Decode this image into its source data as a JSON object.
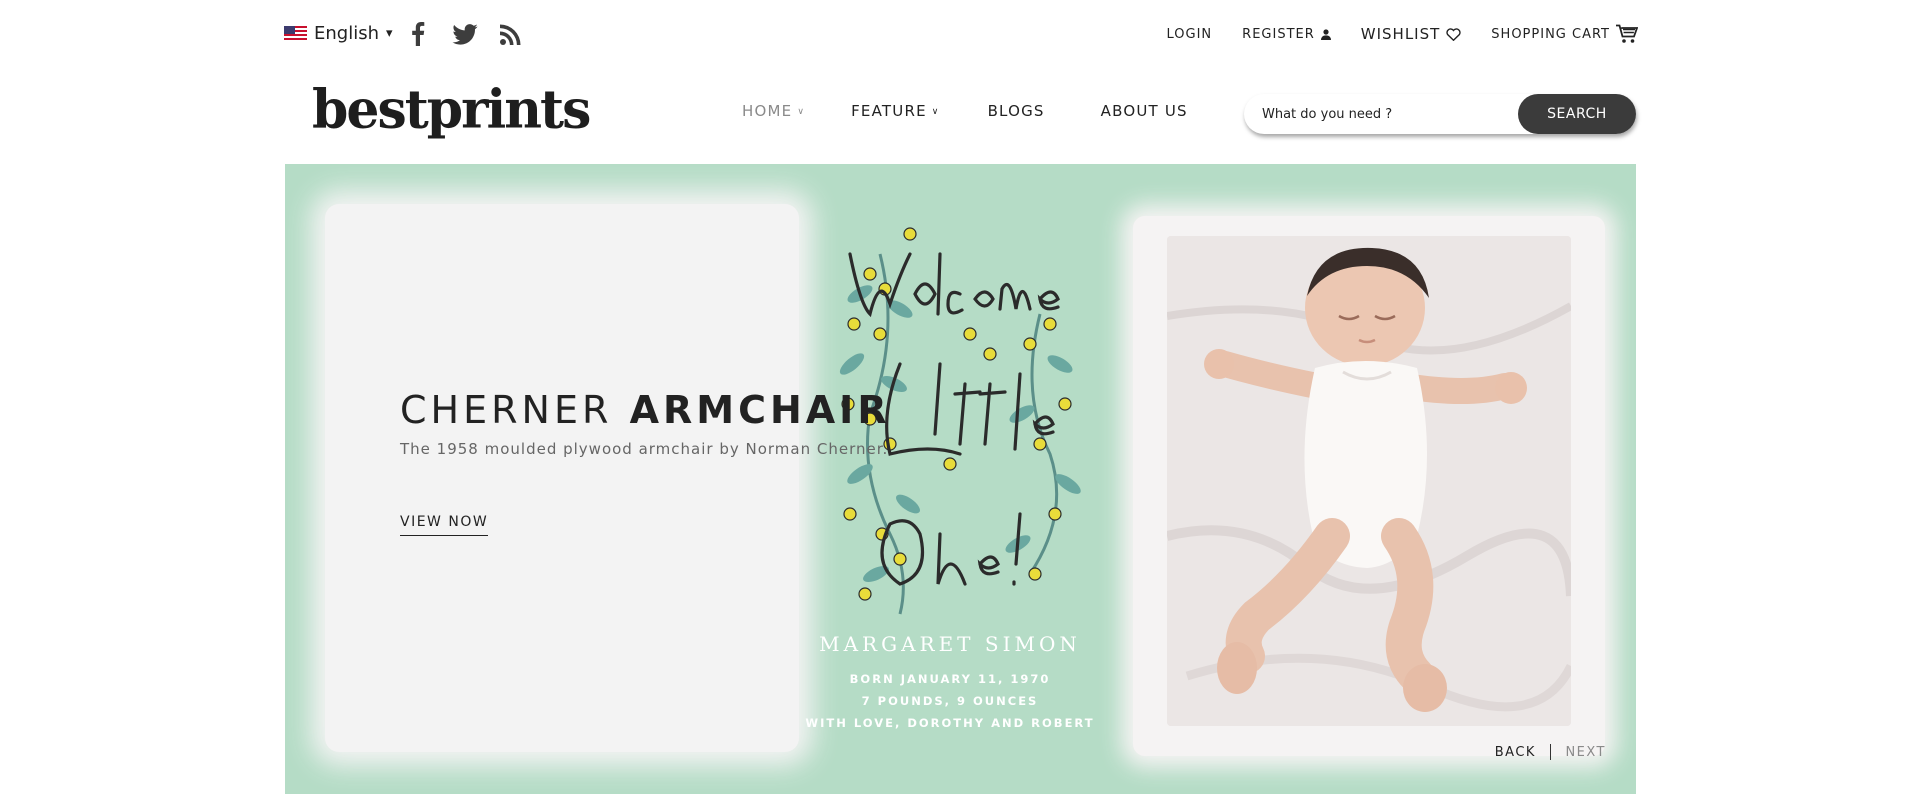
{
  "topbar": {
    "language": {
      "label": "English",
      "caret": "▾",
      "flag_icon": "us-flag-icon"
    },
    "social": [
      {
        "name": "facebook",
        "icon": "facebook-icon"
      },
      {
        "name": "twitter",
        "icon": "twitter-icon"
      },
      {
        "name": "rss",
        "icon": "rss-icon"
      }
    ],
    "links": {
      "login": "LOGIN",
      "register": "REGISTER",
      "wishlist": "WISHLIST",
      "cart": "SHOPPING CART"
    }
  },
  "header": {
    "logo": "bestprints",
    "nav": [
      {
        "label": "HOME",
        "has_dropdown": true,
        "active": true
      },
      {
        "label": "FEATURE",
        "has_dropdown": true,
        "active": false
      },
      {
        "label": "BLOGS",
        "has_dropdown": false,
        "active": false
      },
      {
        "label": "ABOUT US",
        "has_dropdown": false,
        "active": false
      }
    ],
    "search": {
      "placeholder": "What do you need ?",
      "button_label": "SEARCH"
    }
  },
  "hero": {
    "title_light": "CHERNER",
    "title_bold": "ARMCHAIR",
    "subtitle": "The 1958 moulded plywood armchair by Norman Cherner.",
    "cta": "VIEW NOW",
    "card": {
      "name": "MARGARET SIMON",
      "line1": "BORN JANUARY 11, 1970",
      "line2": "7 POUNDS, 9 OUNCES",
      "line3": "WITH LOVE, DOROTHY AND ROBERT",
      "script_text": "Welcome Little One!"
    },
    "slider": {
      "back": "BACK",
      "next": "NEXT"
    },
    "colors": {
      "background": "#b5dcc6",
      "accent_dark": "#3b3b3b"
    }
  }
}
